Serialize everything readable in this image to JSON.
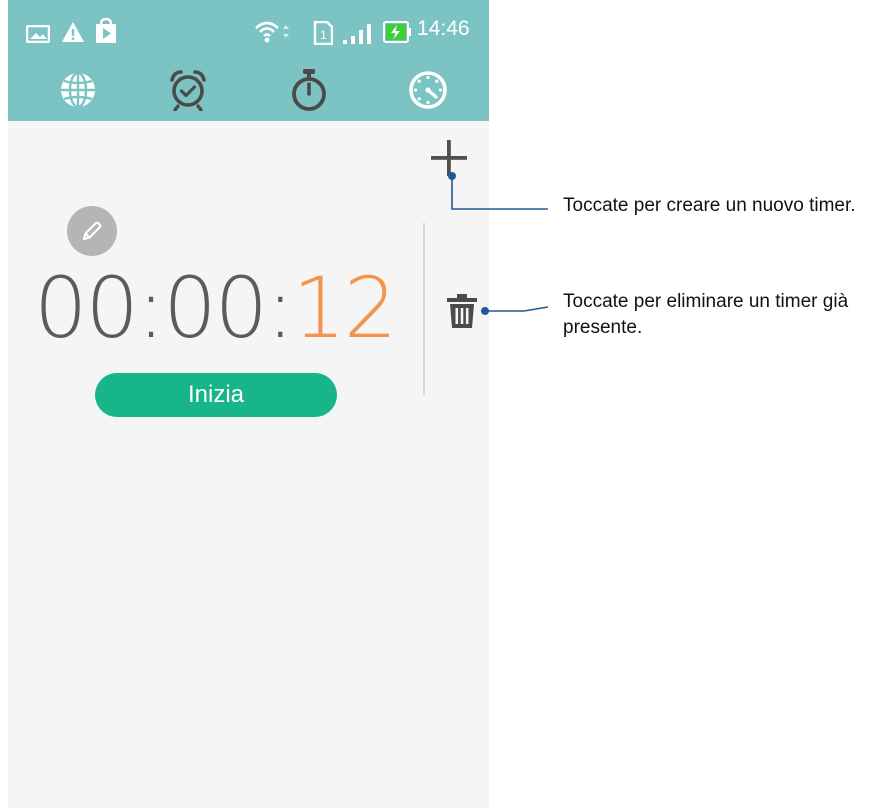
{
  "status_bar": {
    "time": "14:46",
    "sim_label": "1",
    "icons": [
      "image-icon",
      "warning-icon",
      "play-store-icon",
      "wifi-icon",
      "sim-icon",
      "signal-icon",
      "battery-charging-icon"
    ]
  },
  "tabs": [
    {
      "name": "world-clock",
      "icon": "globe-icon"
    },
    {
      "name": "alarm",
      "icon": "alarm-clock-icon"
    },
    {
      "name": "stopwatch",
      "icon": "stopwatch-icon"
    },
    {
      "name": "timer",
      "icon": "timer-icon"
    }
  ],
  "timer": {
    "hours": "00",
    "minutes": "00",
    "seconds": "12",
    "separator": ":",
    "start_label": "Inizia"
  },
  "annotations": {
    "add_text": "Toccate per creare un nuovo timer.",
    "delete_text_line1": "Toccate per eliminare un timer già",
    "delete_text_line2": "presente."
  },
  "colors": {
    "header": "#7cc4c4",
    "accent_orange": "#f0944e",
    "start_button": "#19b58a",
    "callout_line": "#1f5a96"
  }
}
